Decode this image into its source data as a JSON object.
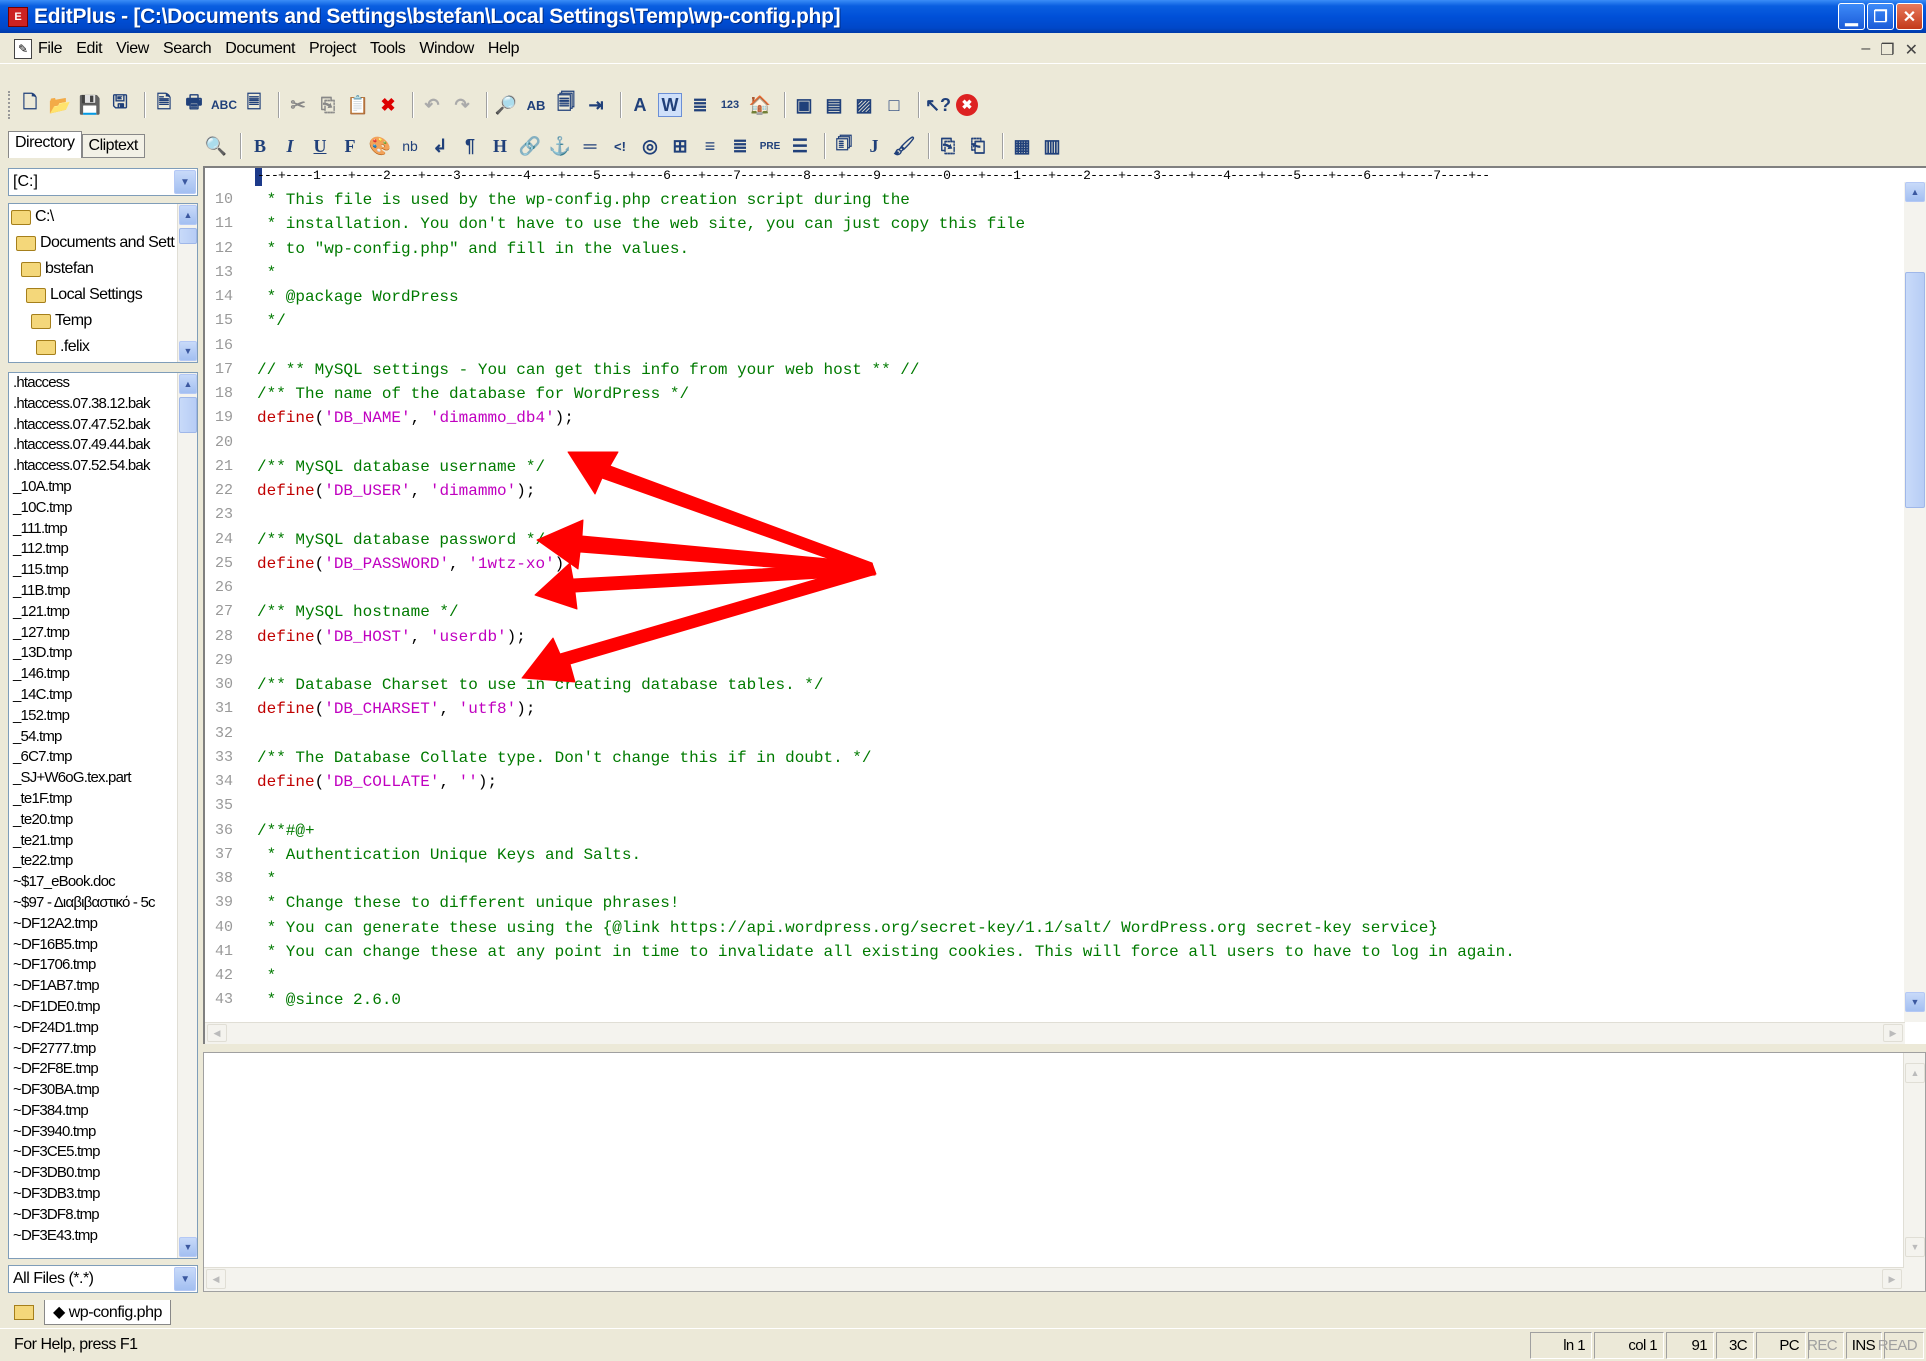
{
  "window": {
    "title": "EditPlus - [C:\\Documents and Settings\\bstefan\\Local Settings\\Temp\\wp-config.php]",
    "app_icon_text": "E"
  },
  "menu": [
    "File",
    "Edit",
    "View",
    "Search",
    "Document",
    "Project",
    "Tools",
    "Window",
    "Help"
  ],
  "left_tabs": {
    "directory": "Directory",
    "cliptext": "Cliptext"
  },
  "drive_combo": "[C:]",
  "folder_tree": [
    {
      "label": "C:\\",
      "indent": 0
    },
    {
      "label": "Documents and Sett",
      "indent": 1
    },
    {
      "label": "bstefan",
      "indent": 2
    },
    {
      "label": "Local Settings",
      "indent": 3
    },
    {
      "label": "Temp",
      "indent": 4
    },
    {
      "label": ".felix",
      "indent": 5
    }
  ],
  "files": [
    ".htaccess",
    ".htaccess.07.38.12.bak",
    ".htaccess.07.47.52.bak",
    ".htaccess.07.49.44.bak",
    ".htaccess.07.52.54.bak",
    "_10A.tmp",
    "_10C.tmp",
    "_111.tmp",
    "_112.tmp",
    "_115.tmp",
    "_11B.tmp",
    "_121.tmp",
    "_127.tmp",
    "_13D.tmp",
    "_146.tmp",
    "_14C.tmp",
    "_152.tmp",
    "_54.tmp",
    "_6C7.tmp",
    "_SJ+W6oG.tex.part",
    "_te1F.tmp",
    "_te20.tmp",
    "_te21.tmp",
    "_te22.tmp",
    "~$17_eBook.doc",
    "~$97 - Διαβιβαστικό - 5c",
    "~DF12A2.tmp",
    "~DF16B5.tmp",
    "~DF1706.tmp",
    "~DF1AB7.tmp",
    "~DF1DE0.tmp",
    "~DF24D1.tmp",
    "~DF2777.tmp",
    "~DF2F8E.tmp",
    "~DF30BA.tmp",
    "~DF384.tmp",
    "~DF3940.tmp",
    "~DF3CE5.tmp",
    "~DF3DB0.tmp",
    "~DF3DB3.tmp",
    "~DF3DF8.tmp",
    "~DF3E43.tmp"
  ],
  "filter_combo": "All Files (*.*)",
  "ruler": "---+----1----+----2----+----3----+----4----+----5----+----6----+----7----+----8----+----9----+----0----+----1----+----2----+----3----+----4----+----5----+----6----+----7----+--",
  "code_lines": [
    {
      "n": "10",
      "parts": [
        {
          "t": " * This file is used by the wp-config.php creation script during the",
          "c": "comment"
        }
      ]
    },
    {
      "n": "11",
      "parts": [
        {
          "t": " * installation. You don't have to use the web site, you can just copy this file",
          "c": "comment"
        }
      ]
    },
    {
      "n": "12",
      "parts": [
        {
          "t": " * to \"wp-config.php\" and fill in the values.",
          "c": "comment"
        }
      ]
    },
    {
      "n": "13",
      "parts": [
        {
          "t": " *",
          "c": "comment"
        }
      ]
    },
    {
      "n": "14",
      "parts": [
        {
          "t": " * @package WordPress",
          "c": "comment"
        }
      ]
    },
    {
      "n": "15",
      "parts": [
        {
          "t": " */",
          "c": "comment"
        }
      ]
    },
    {
      "n": "16",
      "parts": []
    },
    {
      "n": "17",
      "parts": [
        {
          "t": "// ** MySQL settings - You can get this info from your web host ** //",
          "c": "comment"
        }
      ]
    },
    {
      "n": "18",
      "parts": [
        {
          "t": "/** The name of the database for WordPress */",
          "c": "comment"
        }
      ]
    },
    {
      "n": "19",
      "parts": [
        {
          "t": "define",
          "c": "define"
        },
        {
          "t": "(",
          "c": "punct"
        },
        {
          "t": "'DB_NAME'",
          "c": "str"
        },
        {
          "t": ", ",
          "c": "punct"
        },
        {
          "t": "'dimammo_db4'",
          "c": "str"
        },
        {
          "t": ");",
          "c": "punct"
        }
      ]
    },
    {
      "n": "20",
      "parts": []
    },
    {
      "n": "21",
      "parts": [
        {
          "t": "/** MySQL database username */",
          "c": "comment"
        }
      ]
    },
    {
      "n": "22",
      "parts": [
        {
          "t": "define",
          "c": "define"
        },
        {
          "t": "(",
          "c": "punct"
        },
        {
          "t": "'DB_USER'",
          "c": "str"
        },
        {
          "t": ", ",
          "c": "punct"
        },
        {
          "t": "'dimammo'",
          "c": "str"
        },
        {
          "t": ");",
          "c": "punct"
        }
      ]
    },
    {
      "n": "23",
      "parts": []
    },
    {
      "n": "24",
      "parts": [
        {
          "t": "/** MySQL database password */",
          "c": "comment"
        }
      ]
    },
    {
      "n": "25",
      "parts": [
        {
          "t": "define",
          "c": "define"
        },
        {
          "t": "(",
          "c": "punct"
        },
        {
          "t": "'DB_PASSWORD'",
          "c": "str"
        },
        {
          "t": ", ",
          "c": "punct"
        },
        {
          "t": "'1wtz-xo'",
          "c": "str"
        },
        {
          "t": ");",
          "c": "punct"
        }
      ]
    },
    {
      "n": "26",
      "parts": []
    },
    {
      "n": "27",
      "parts": [
        {
          "t": "/** MySQL hostname */",
          "c": "comment"
        }
      ]
    },
    {
      "n": "28",
      "parts": [
        {
          "t": "define",
          "c": "define"
        },
        {
          "t": "(",
          "c": "punct"
        },
        {
          "t": "'DB_HOST'",
          "c": "str"
        },
        {
          "t": ", ",
          "c": "punct"
        },
        {
          "t": "'userdb'",
          "c": "str"
        },
        {
          "t": ");",
          "c": "punct"
        }
      ]
    },
    {
      "n": "29",
      "parts": []
    },
    {
      "n": "30",
      "parts": [
        {
          "t": "/** Database Charset to use in creating database tables. */",
          "c": "comment"
        }
      ]
    },
    {
      "n": "31",
      "parts": [
        {
          "t": "define",
          "c": "define"
        },
        {
          "t": "(",
          "c": "punct"
        },
        {
          "t": "'DB_CHARSET'",
          "c": "str"
        },
        {
          "t": ", ",
          "c": "punct"
        },
        {
          "t": "'utf8'",
          "c": "str"
        },
        {
          "t": ");",
          "c": "punct"
        }
      ]
    },
    {
      "n": "32",
      "parts": []
    },
    {
      "n": "33",
      "parts": [
        {
          "t": "/** The Database Collate type. Don't change this if in doubt. */",
          "c": "comment"
        }
      ]
    },
    {
      "n": "34",
      "parts": [
        {
          "t": "define",
          "c": "define"
        },
        {
          "t": "(",
          "c": "punct"
        },
        {
          "t": "'DB_COLLATE'",
          "c": "str"
        },
        {
          "t": ", ",
          "c": "punct"
        },
        {
          "t": "''",
          "c": "str"
        },
        {
          "t": ");",
          "c": "punct"
        }
      ]
    },
    {
      "n": "35",
      "parts": []
    },
    {
      "n": "36",
      "parts": [
        {
          "t": "/**#@+",
          "c": "comment"
        }
      ]
    },
    {
      "n": "37",
      "parts": [
        {
          "t": " * Authentication Unique Keys and Salts.",
          "c": "comment"
        }
      ]
    },
    {
      "n": "38",
      "parts": [
        {
          "t": " *",
          "c": "comment"
        }
      ]
    },
    {
      "n": "39",
      "parts": [
        {
          "t": " * Change these to different unique phrases!",
          "c": "comment"
        }
      ]
    },
    {
      "n": "40",
      "parts": [
        {
          "t": " * You can generate these using the {@link https://api.wordpress.org/secret-key/1.1/salt/ WordPress.org secret-key service}",
          "c": "comment"
        }
      ]
    },
    {
      "n": "41",
      "parts": [
        {
          "t": " * You can change these at any point in time to invalidate all existing cookies. This will force all users to have to log in again.",
          "c": "comment"
        }
      ]
    },
    {
      "n": "42",
      "parts": [
        {
          "t": " *",
          "c": "comment"
        }
      ]
    },
    {
      "n": "43",
      "parts": [
        {
          "t": " * @since 2.6.0",
          "c": "comment"
        }
      ]
    }
  ],
  "doc_tab": "◆ wp-config.php",
  "status": {
    "help": "For Help, press F1",
    "ln": "ln 1",
    "col": "col 1",
    "c1": "91",
    "c2": "3C",
    "pc": "PC",
    "rec": "REC",
    "ins": "INS",
    "read": "READ"
  },
  "colors": {
    "comment": "#007a00",
    "define": "#c00000",
    "string": "#c000c0",
    "arrow": "#ff0000"
  }
}
